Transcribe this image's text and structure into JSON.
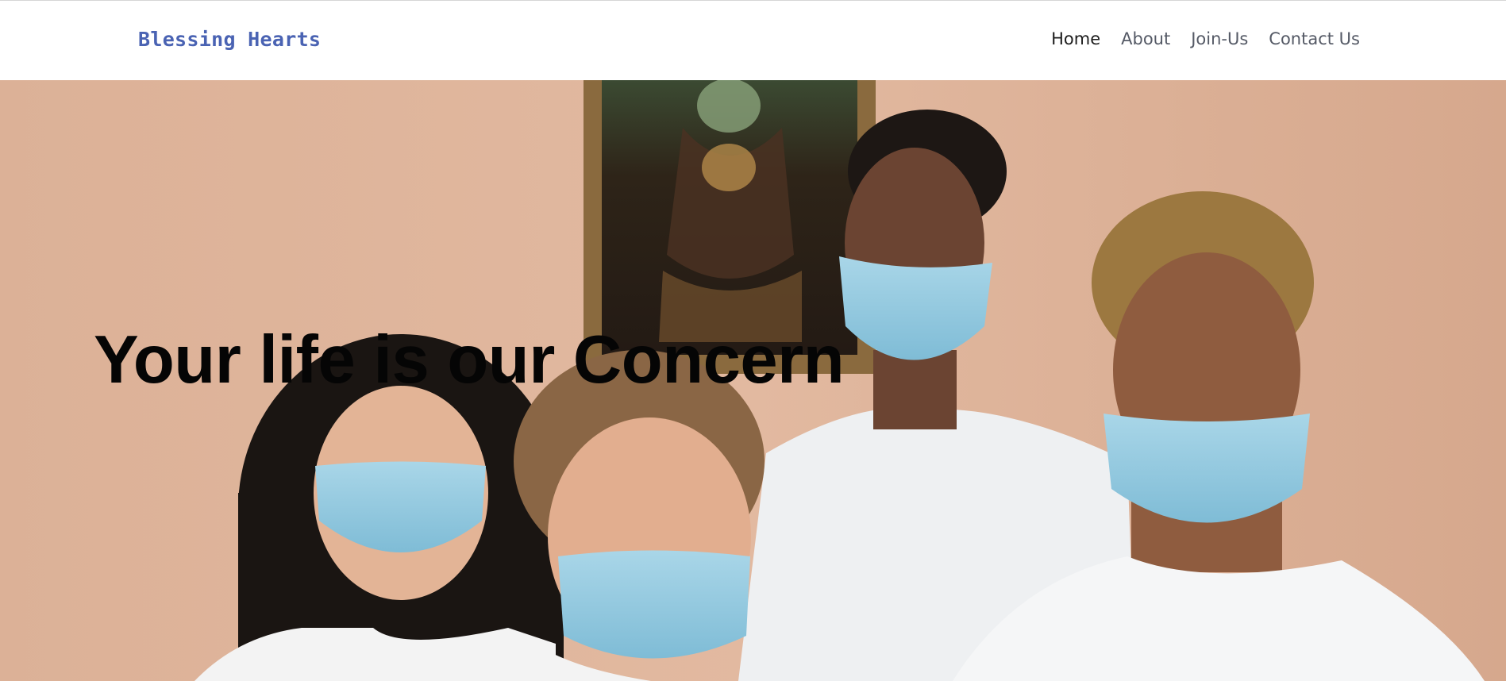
{
  "header": {
    "brand": "Blessing Hearts",
    "nav": [
      {
        "label": "Home",
        "active": true
      },
      {
        "label": "About",
        "active": false
      },
      {
        "label": "Join-Us",
        "active": false
      },
      {
        "label": "Contact Us",
        "active": false
      }
    ]
  },
  "hero": {
    "headline": "Your life is our Concern",
    "image_subject": "four people wearing blue surgical face masks in front of a masked Mona Lisa painting"
  },
  "colors": {
    "brand": "#4a63b3",
    "nav_text": "#555a66",
    "nav_active": "#1c1c1c",
    "hero_background": "#d9ad92",
    "mask_blue": "#8ec6de",
    "headline": "#050505"
  }
}
